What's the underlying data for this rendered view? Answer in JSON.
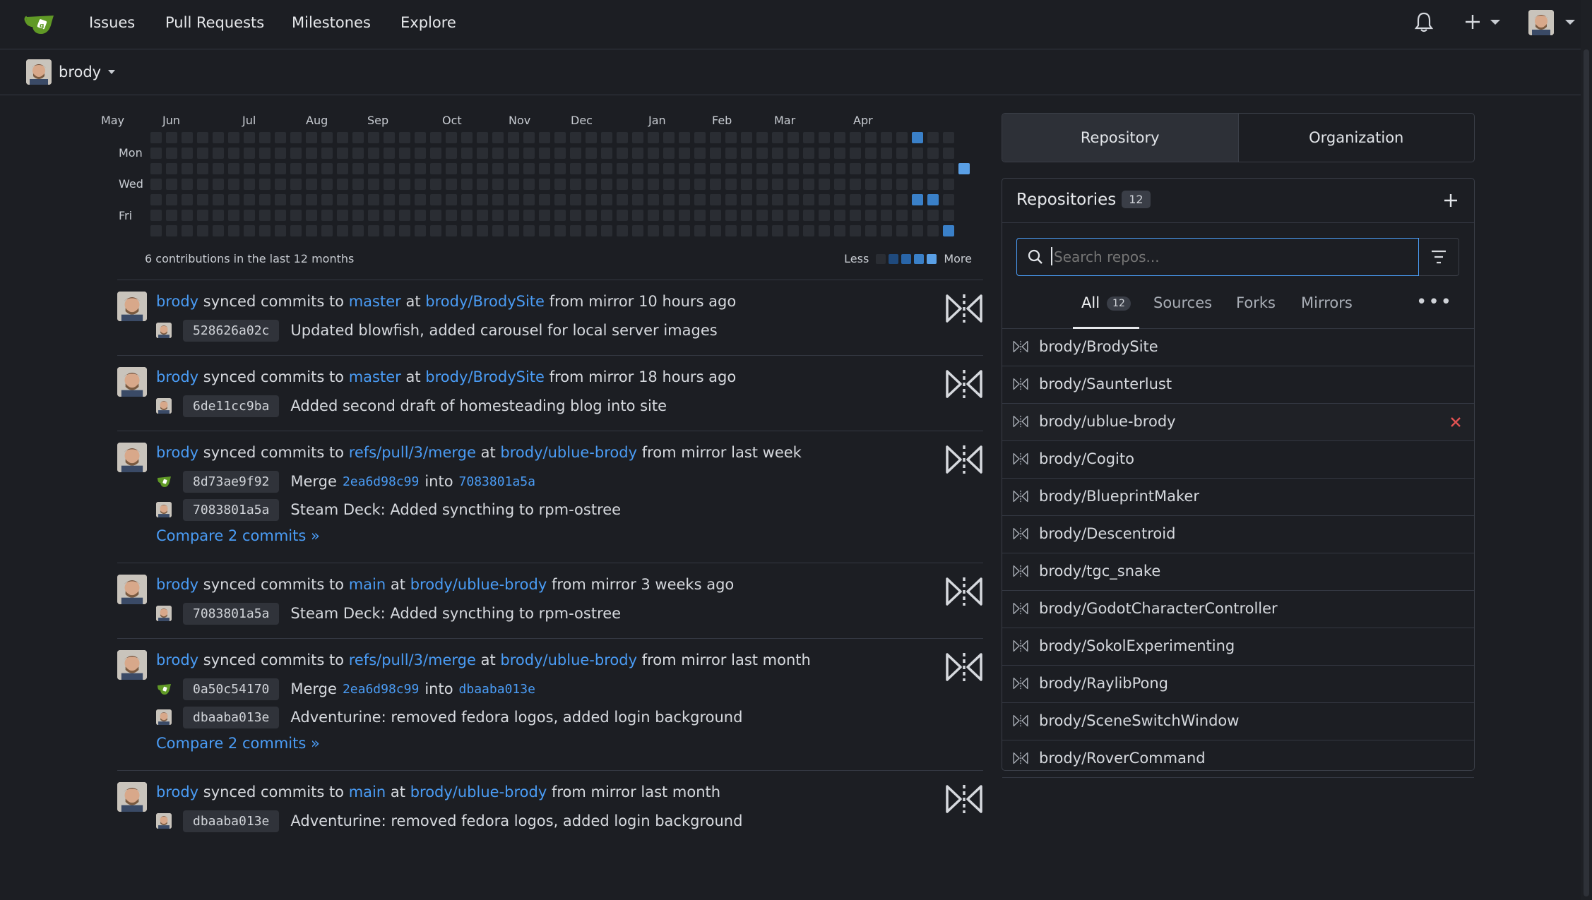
{
  "nav": {
    "items": [
      "Issues",
      "Pull Requests",
      "Milestones",
      "Explore"
    ],
    "logo_icon": "gitea-teacup-icon",
    "right_icons": [
      "bell-icon",
      "plus-icon",
      "avatar"
    ]
  },
  "context": {
    "user": "brody"
  },
  "heatmap": {
    "months": [
      "May",
      "Jun",
      "Jul",
      "Aug",
      "Sep",
      "Oct",
      "Nov",
      "Dec",
      "Jan",
      "Feb",
      "Mar",
      "Apr"
    ],
    "days": [
      "Mon",
      "Wed",
      "Fri"
    ],
    "summary": "6 contributions in the last 12 months",
    "less": "Less",
    "more": "More",
    "active_cells": [
      {
        "week": 49,
        "day": 0,
        "level": 2
      },
      {
        "week": 52,
        "day": 2,
        "level": 3
      },
      {
        "week": 49,
        "day": 4,
        "level": 2
      },
      {
        "week": 50,
        "day": 4,
        "level": 2
      },
      {
        "week": 51,
        "day": 6,
        "level": 2
      }
    ],
    "colors": [
      "#2a2d33",
      "#1f4a7d",
      "#2965a8",
      "#3a80c8",
      "#5aa0e6"
    ]
  },
  "feed": [
    {
      "user": "brody",
      "verb": "synced commits to",
      "ref": "master",
      "at": "at",
      "repo": "brody/BrodySite",
      "suffix": "from mirror 10 hours ago",
      "commits": [
        {
          "sha": "528626a02c",
          "msg": "Updated blowfish, added carousel for local server images"
        }
      ]
    },
    {
      "user": "brody",
      "verb": "synced commits to",
      "ref": "master",
      "at": "at",
      "repo": "brody/BrodySite",
      "suffix": "from mirror 18 hours ago",
      "commits": [
        {
          "sha": "6de11cc9ba",
          "msg": "Added second draft of homesteading blog into site"
        }
      ]
    },
    {
      "user": "brody",
      "verb": "synced commits to",
      "ref": "refs/pull/3/merge",
      "at": "at",
      "repo": "brody/ublue-brody",
      "suffix": "from mirror last week",
      "merge": {
        "sha": "8d73ae9f92",
        "word": "Merge",
        "from": "2ea6d98c99",
        "into_word": "into",
        "into": "7083801a5a"
      },
      "commits": [
        {
          "sha": "7083801a5a",
          "msg": "Steam Deck: Added syncthing to rpm-ostree"
        }
      ],
      "compare": "Compare 2 commits »"
    },
    {
      "user": "brody",
      "verb": "synced commits to",
      "ref": "main",
      "at": "at",
      "repo": "brody/ublue-brody",
      "suffix": "from mirror 3 weeks ago",
      "commits": [
        {
          "sha": "7083801a5a",
          "msg": "Steam Deck: Added syncthing to rpm-ostree"
        }
      ]
    },
    {
      "user": "brody",
      "verb": "synced commits to",
      "ref": "refs/pull/3/merge",
      "at": "at",
      "repo": "brody/ublue-brody",
      "suffix": "from mirror last month",
      "merge": {
        "sha": "0a50c54170",
        "word": "Merge",
        "from": "2ea6d98c99",
        "into_word": "into",
        "into": "dbaaba013e"
      },
      "commits": [
        {
          "sha": "dbaaba013e",
          "msg": "Adventurine: removed fedora logos, added login background"
        }
      ],
      "compare": "Compare 2 commits »"
    },
    {
      "user": "brody",
      "verb": "synced commits to",
      "ref": "main",
      "at": "at",
      "repo": "brody/ublue-brody",
      "suffix": "from mirror last month",
      "commits": [
        {
          "sha": "dbaaba013e",
          "msg": "Adventurine: removed fedora logos, added login background"
        }
      ]
    }
  ],
  "panel": {
    "tabs": [
      "Repository",
      "Organization"
    ],
    "title": "Repositories",
    "count": "12",
    "search_placeholder": "Search repos...",
    "subtabs": {
      "all": "All",
      "all_count": "12",
      "sources": "Sources",
      "forks": "Forks",
      "mirrors": "Mirrors"
    },
    "repos": [
      "brody/BrodySite",
      "brody/Saunterlust",
      "brody/ublue-brody",
      "brody/Cogito",
      "brody/BlueprintMaker",
      "brody/Descentroid",
      "brody/tgc_snake",
      "brody/GodotCharacterController",
      "brody/SokolExperimenting",
      "brody/RaylibPong",
      "brody/SceneSwitchWindow",
      "brody/RoverCommand"
    ],
    "hovered_repo_index": 2,
    "accent": "#4a9cf5",
    "danger": "#e05252"
  }
}
